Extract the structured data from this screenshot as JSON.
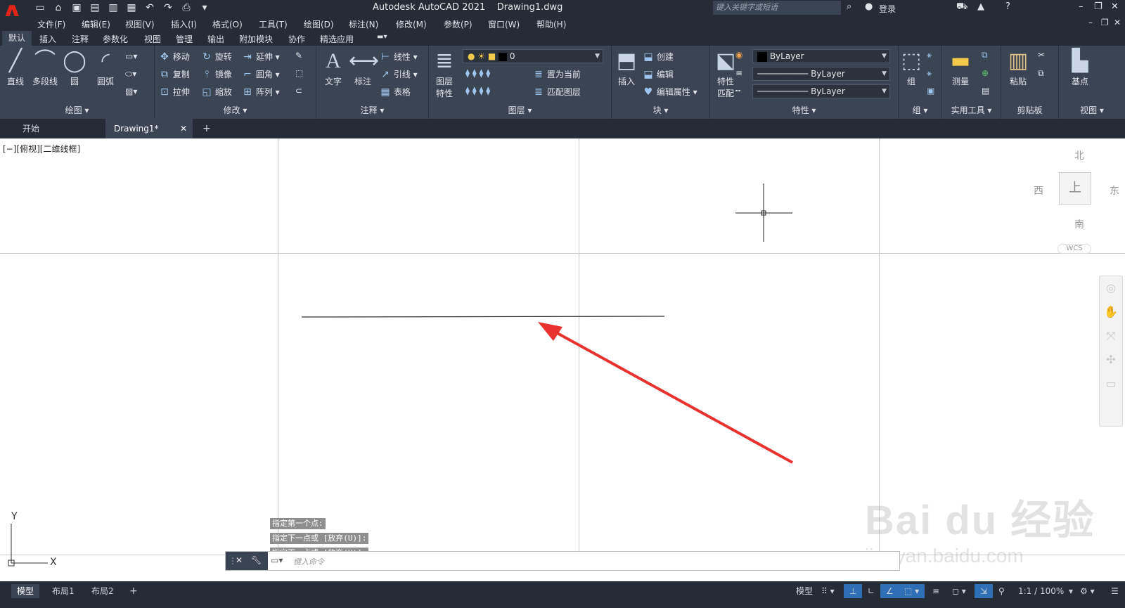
{
  "app": {
    "title": "Autodesk AutoCAD 2021",
    "document": "Drawing1.dwg",
    "logo": "A"
  },
  "search": {
    "placeholder": "键入关键字或短语"
  },
  "account": {
    "login": "登录"
  },
  "menus": [
    "文件(F)",
    "编辑(E)",
    "视图(V)",
    "插入(I)",
    "格式(O)",
    "工具(T)",
    "绘图(D)",
    "标注(N)",
    "修改(M)",
    "参数(P)",
    "窗口(W)",
    "帮助(H)"
  ],
  "ribbon_tabs": [
    "默认",
    "插入",
    "注释",
    "参数化",
    "视图",
    "管理",
    "输出",
    "附加模块",
    "协作",
    "精选应用"
  ],
  "panels": {
    "draw": {
      "title": "绘图",
      "line": "直线",
      "polyline": "多段线",
      "circle": "圆",
      "arc": "圆弧"
    },
    "modify": {
      "title": "修改",
      "move": "移动",
      "rotate": "旋转",
      "trim": "延伸",
      "copy": "复制",
      "mirror": "镜像",
      "fillet": "圆角",
      "stretch": "拉伸",
      "scale": "缩放",
      "array": "阵列"
    },
    "annotation": {
      "title": "注释",
      "text": "文字",
      "dimension": "标注",
      "linear": "线性",
      "leader": "引线",
      "table": "表格"
    },
    "layers": {
      "title": "图层",
      "props1": "图层",
      "props2": "特性",
      "current_layer": "0",
      "set_current": "置为当前",
      "match": "匹配图层"
    },
    "block": {
      "title": "块",
      "insert": "插入",
      "create": "创建",
      "edit": "编辑",
      "edit_attr": "编辑属性"
    },
    "properties": {
      "title": "特性",
      "match1": "特性",
      "match2": "匹配",
      "color": "ByLayer",
      "linetype": "ByLayer",
      "lineweight": "ByLayer"
    },
    "groups": {
      "title": "组",
      "group": "组"
    },
    "utilities": {
      "title": "实用工具",
      "measure": "测量"
    },
    "clipboard": {
      "title": "剪贴板",
      "paste": "粘贴"
    },
    "view": {
      "title": "视图",
      "base": "基点"
    }
  },
  "file_tabs": [
    "开始",
    "Drawing1*"
  ],
  "viewport_label": "[−][俯视][二维线框]",
  "viewcube": {
    "north": "北",
    "south": "南",
    "east": "东",
    "west": "西",
    "top": "上",
    "wcs": "WCS"
  },
  "ucs": {
    "x": "X",
    "y": "Y"
  },
  "command_history": [
    "指定第一个点:",
    "指定下一点或 [放弃(U)]:",
    "指定下一点或 [放弃(U)]:"
  ],
  "command_input": {
    "placeholder": "键入命令"
  },
  "layout_tabs": [
    "模型",
    "布局1",
    "布局2"
  ],
  "status": {
    "model": "模型",
    "scale": "1:1 / 100%"
  },
  "watermark": {
    "line1": "Bai du 经验",
    "line2": "jingyan.baidu.com"
  }
}
